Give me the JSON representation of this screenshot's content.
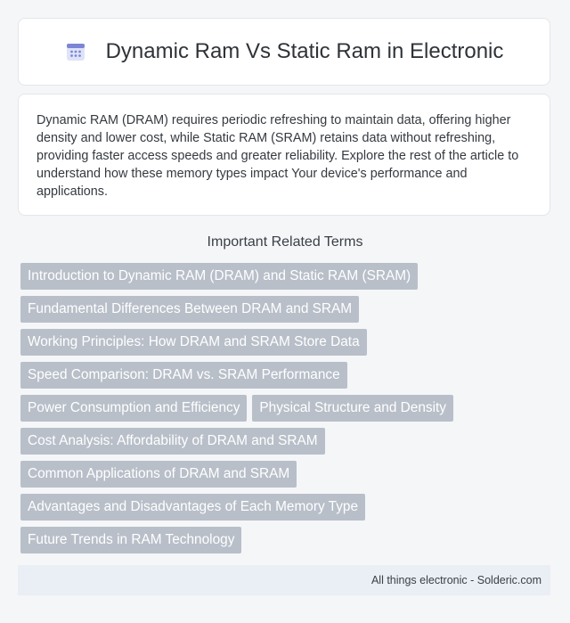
{
  "header": {
    "icon": "calendar-icon",
    "title": "Dynamic Ram Vs Static Ram in Electronic"
  },
  "summary": {
    "text": "Dynamic RAM (DRAM) requires periodic refreshing to maintain data, offering higher density and lower cost, while Static RAM (SRAM) retains data without refreshing, providing faster access speeds and greater reliability. Explore the rest of the article to understand how these memory types impact Your device's performance and applications."
  },
  "related": {
    "heading": "Important Related Terms",
    "terms": [
      "Introduction to Dynamic RAM (DRAM) and Static RAM (SRAM)",
      "Fundamental Differences Between DRAM and SRAM",
      "Working Principles: How DRAM and SRAM Store Data",
      "Speed Comparison: DRAM vs. SRAM Performance",
      "Power Consumption and Efficiency",
      "Physical Structure and Density",
      "Cost Analysis: Affordability of DRAM and SRAM",
      "Common Applications of DRAM and SRAM",
      "Advantages and Disadvantages of Each Memory Type",
      "Future Trends in RAM Technology"
    ]
  },
  "footer": {
    "text": "All things electronic - Solderic.com"
  },
  "colors": {
    "chip_background": "#b8bfc9",
    "icon_accent": "#7b86d6",
    "footer_background": "#eaeef5"
  }
}
